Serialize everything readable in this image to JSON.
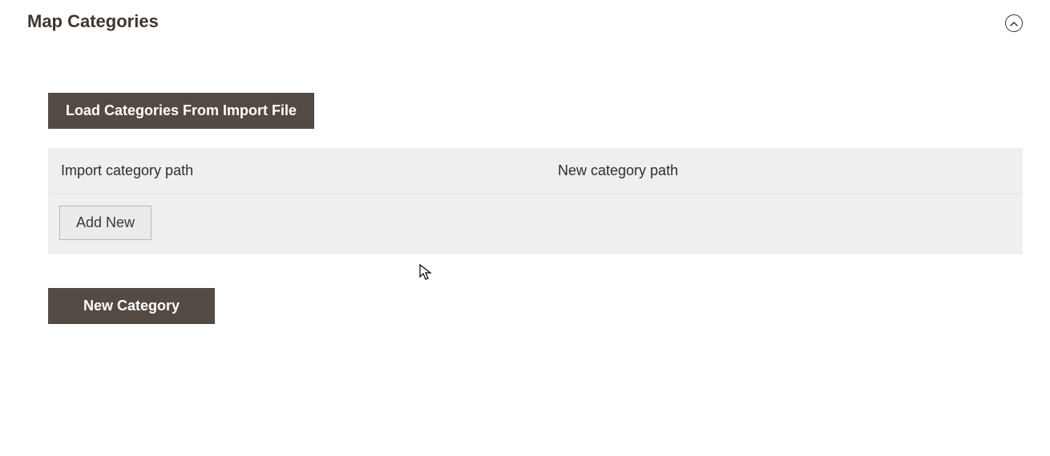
{
  "section": {
    "title": "Map Categories"
  },
  "buttons": {
    "load_categories": "Load Categories From Import File",
    "add_new": "Add New",
    "new_category": "New Category"
  },
  "table": {
    "headers": {
      "import_path": "Import category path",
      "new_path": "New category path"
    }
  }
}
